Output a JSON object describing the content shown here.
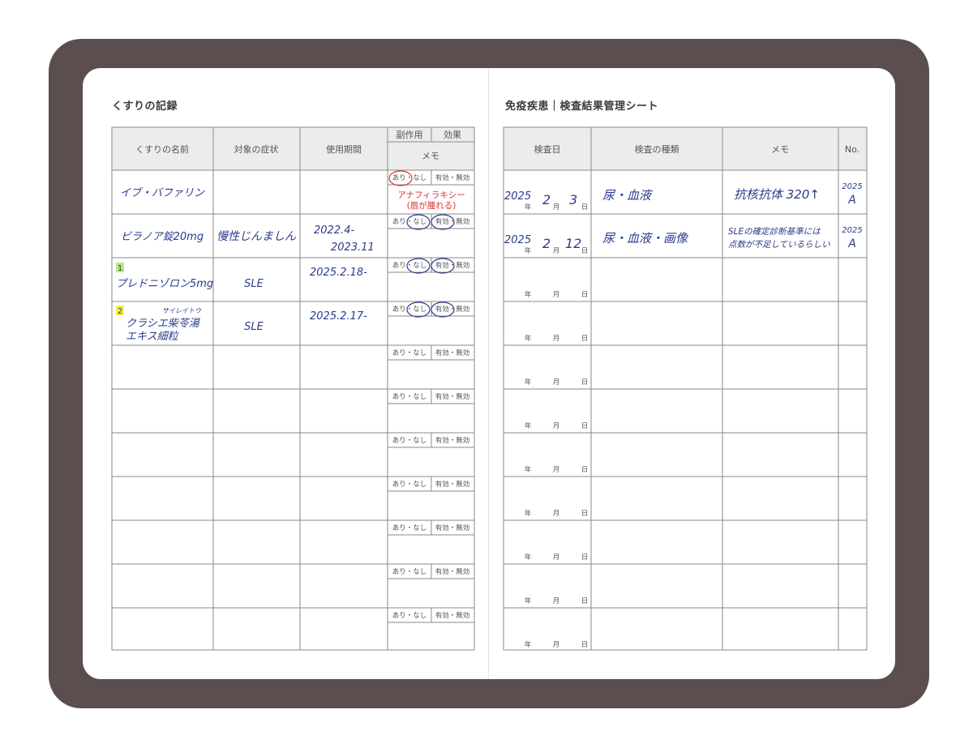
{
  "left_page": {
    "title": "くすりの記録",
    "headers": {
      "name": "くすりの名前",
      "symptom": "対象の症状",
      "period": "使用期間",
      "side_effect": "副作用",
      "effect": "効果",
      "memo": "メモ"
    },
    "option_side": "あり・なし",
    "option_effect": "有効・無効",
    "rows": [
      {
        "name": "イブ・バファリン",
        "symptom": "",
        "period_1": "",
        "period_2": "",
        "memo_1": "アナフィラキシー",
        "memo_2": "(唇が腫れる)",
        "badge": "",
        "furigana": ""
      },
      {
        "name": "ビラノア錠20mg",
        "symptom": "慢性じんましん",
        "period_1": "2022.4-",
        "period_2": "2023.11",
        "memo_1": "",
        "memo_2": "",
        "badge": "",
        "furigana": ""
      },
      {
        "name": "プレドニゾロン5mg",
        "symptom": "SLE",
        "period_1": "2025.2.18-",
        "period_2": "",
        "memo_1": "",
        "memo_2": "",
        "badge": "1",
        "furigana": ""
      },
      {
        "name": "クラシエ柴苓湯",
        "name_2": "エキス細粒",
        "symptom": "SLE",
        "period_1": "2025.2.17-",
        "period_2": "",
        "memo_1": "",
        "memo_2": "",
        "badge": "2",
        "furigana": "サイレイトウ"
      }
    ]
  },
  "right_page": {
    "title": "免疫疾患｜検査結果管理シート",
    "headers": {
      "date": "検査日",
      "type": "検査の種類",
      "memo": "メモ",
      "no": "No."
    },
    "ymd": {
      "y": "年",
      "m": "月",
      "d": "日"
    },
    "rows": [
      {
        "year": "2025",
        "month": "2",
        "day": "3",
        "type": "尿・血液",
        "memo_1": "抗核抗体 320↑",
        "memo_2": "",
        "no_1": "2025",
        "no_2": "A"
      },
      {
        "year": "2025",
        "month": "2",
        "day": "12",
        "type": "尿・血液・画像",
        "memo_1": "SLEの確定診断基準には",
        "memo_2": "点数が不足しているらしい",
        "no_1": "2025",
        "no_2": "A"
      }
    ]
  },
  "colors": {
    "frame": "#5a4f4e",
    "ink": "#2a3a8c",
    "red_ink": "#e03030",
    "badge_green": "#b8e986",
    "badge_yellow": "#f5f04a"
  }
}
